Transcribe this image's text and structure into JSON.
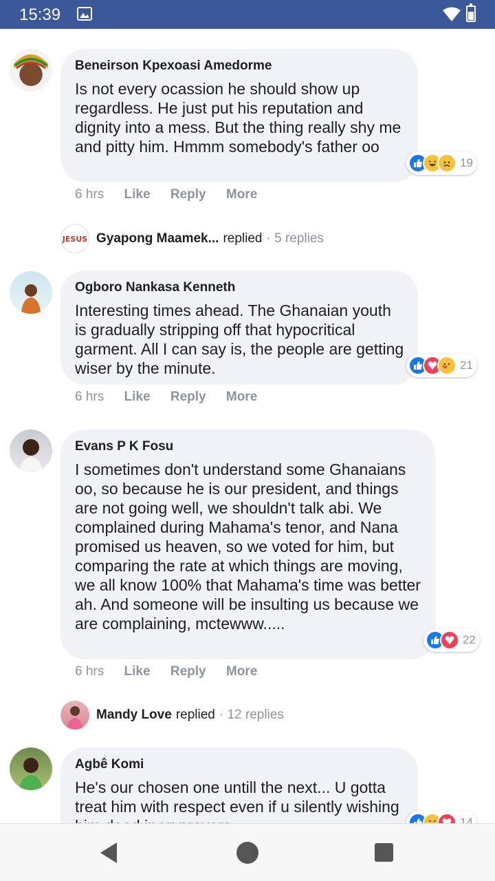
{
  "status_bar": {
    "time": "15:39"
  },
  "comments": [
    {
      "author": "Beneirson Kpexoasi Amedorme",
      "text": "Is not every ocassion he should show up regardless. He just put his reputation and dignity into a mess. But the thing really shy me and pitty him. Hmmm somebody's father oo",
      "time": "6 hrs",
      "like": "Like",
      "reply": "Reply",
      "more": "More",
      "reactions": [
        "like",
        "haha",
        "sad"
      ],
      "reaction_count": "19"
    },
    {
      "author": "Ogboro Nankasa Kenneth",
      "text": "Interesting times ahead. The Ghanaian youth is gradually stripping off that hypocritical garment. All I can say is, the people are getting wiser by the minute.",
      "time": "6 hrs",
      "like": "Like",
      "reply": "Reply",
      "more": "More",
      "reactions": [
        "like",
        "love",
        "care"
      ],
      "reaction_count": "21"
    },
    {
      "author": "Evans P K Fosu",
      "text": "I sometimes don't understand some Ghanaians oo, so because he is our president, and things are not going well, we shouldn't talk abi. We complained during Mahama's tenor, and Nana promised us heaven, so we voted for him, but comparing the rate at which things are moving, we all know 100% that Mahama's time was better ah. And someone will be insulting us because we are complaining, mctewww.....",
      "time": "6 hrs",
      "like": "Like",
      "reply": "Reply",
      "more": "More",
      "reactions": [
        "like",
        "love"
      ],
      "reaction_count": "22"
    },
    {
      "author": "Agbê Komi",
      "text": "He's our chosen one untill the next... U gotta treat him with respect even if u silently wishing him dead in yr prayers",
      "reactions": [
        "like",
        "haha",
        "love"
      ],
      "reaction_count": "14"
    }
  ],
  "reply_threads": [
    {
      "avatar_text": "JESUS",
      "name": "Gyapong Maamek...",
      "verb": "replied",
      "count": "· 5 replies"
    },
    {
      "name": "Mandy Love",
      "verb": "replied",
      "count": "· 12 replies"
    }
  ],
  "colors": {
    "status_bar": "#3b5998",
    "bubble": "#f0f2f5",
    "like": "#1877f2",
    "love": "#f33e58",
    "haha": "#f7c23a"
  }
}
